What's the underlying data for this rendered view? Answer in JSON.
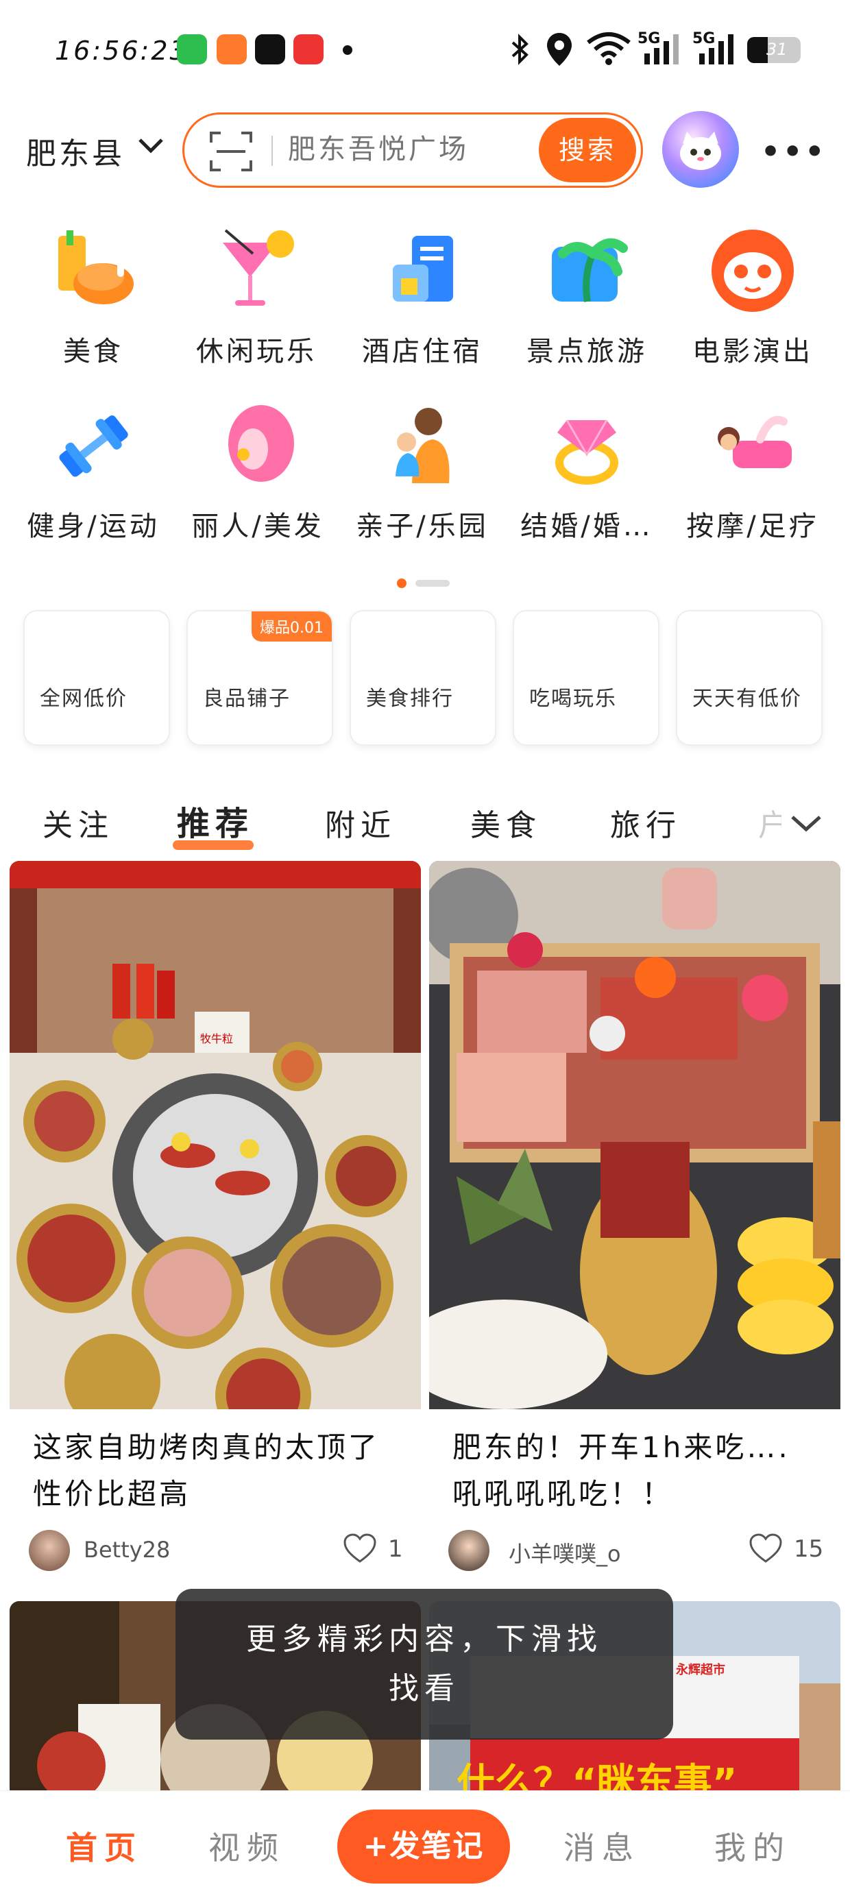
{
  "status_bar": {
    "time": "16:56:23",
    "signal1": "5G",
    "signal2": "5G",
    "battery": "31",
    "icons": [
      "bluetooth-icon",
      "location-icon",
      "wifi-icon",
      "signal-icon",
      "battery-icon"
    ]
  },
  "header": {
    "city": "肥东县",
    "search_placeholder": "肥东吾悦广场",
    "search_button": "搜索",
    "more": "•••"
  },
  "categories": [
    {
      "label": "美食",
      "icon": "food-icon"
    },
    {
      "label": "休闲玩乐",
      "icon": "cocktail-icon"
    },
    {
      "label": "酒店住宿",
      "icon": "hotel-icon"
    },
    {
      "label": "景点旅游",
      "icon": "palm-icon"
    },
    {
      "label": "电影演出",
      "icon": "cat-mascot-icon"
    },
    {
      "label": "健身/运动",
      "icon": "dumbbell-icon"
    },
    {
      "label": "丽人/美发",
      "icon": "beauty-icon"
    },
    {
      "label": "亲子/乐园",
      "icon": "parent-child-icon"
    },
    {
      "label": "结婚/婚…",
      "icon": "ring-icon"
    },
    {
      "label": "按摩/足疗",
      "icon": "massage-icon"
    }
  ],
  "quick_cards": [
    {
      "label": "全网低价"
    },
    {
      "label": "良品铺子",
      "badge": "爆品0.01"
    },
    {
      "label": "美食排行"
    },
    {
      "label": "吃喝玩乐"
    },
    {
      "label": "天天有低价"
    }
  ],
  "tabs": [
    "关注",
    "推荐",
    "附近",
    "美食",
    "旅行",
    "户"
  ],
  "active_tab": "推荐",
  "feed": [
    {
      "title": "这家自助烤肉真的太顶了性价比超高",
      "title_line1": "这家自助烤肉真的太顶了",
      "title_line2": "性价比超高",
      "user": "Betty28",
      "likes": "1"
    },
    {
      "title": "肥东的！开车1h来吃….吼吼吼吼吃！！",
      "title_line1": "肥东的！开车1h来吃….",
      "title_line2": "吼吼吼吼吃！！",
      "user": "小羊噗噗_o",
      "likes": "15"
    }
  ],
  "photo_texts": {
    "sign": "永辉超市",
    "banner": "什么？“眯东事”",
    "sauce_label": "牧牛粒"
  },
  "toast": {
    "line1": "更多精彩内容，下滑找",
    "line2": "找看"
  },
  "bottom_nav": {
    "home": "首页",
    "video": "视频",
    "post": "+发笔记",
    "messages": "消息",
    "me": "我的"
  },
  "colors": {
    "accent": "#ff5a22",
    "search_border": "#ff6a1a"
  }
}
